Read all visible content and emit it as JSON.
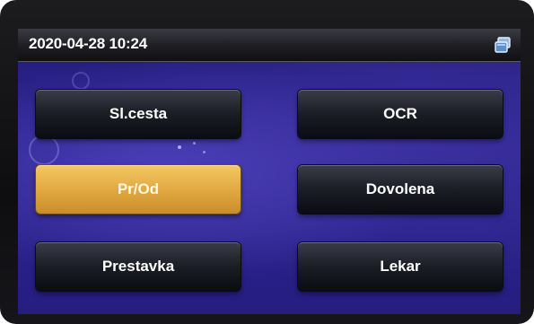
{
  "header": {
    "datetime": "2020-04-28 10:24",
    "icon": "window-switch-icon"
  },
  "buttons": [
    {
      "id": "sl-cesta",
      "label": "Sl.cesta",
      "selected": false
    },
    {
      "id": "ocr",
      "label": "OCR",
      "selected": false
    },
    {
      "id": "pr-od",
      "label": "Pr/Od",
      "selected": true
    },
    {
      "id": "dovolena",
      "label": "Dovolena",
      "selected": false
    },
    {
      "id": "prestavka",
      "label": "Prestavka",
      "selected": false
    },
    {
      "id": "lekar",
      "label": "Lekar",
      "selected": false
    }
  ],
  "colors": {
    "screen_bg": "#2e2690",
    "button_bg": "#1b1d25",
    "selected_bg": "#e2a941"
  }
}
